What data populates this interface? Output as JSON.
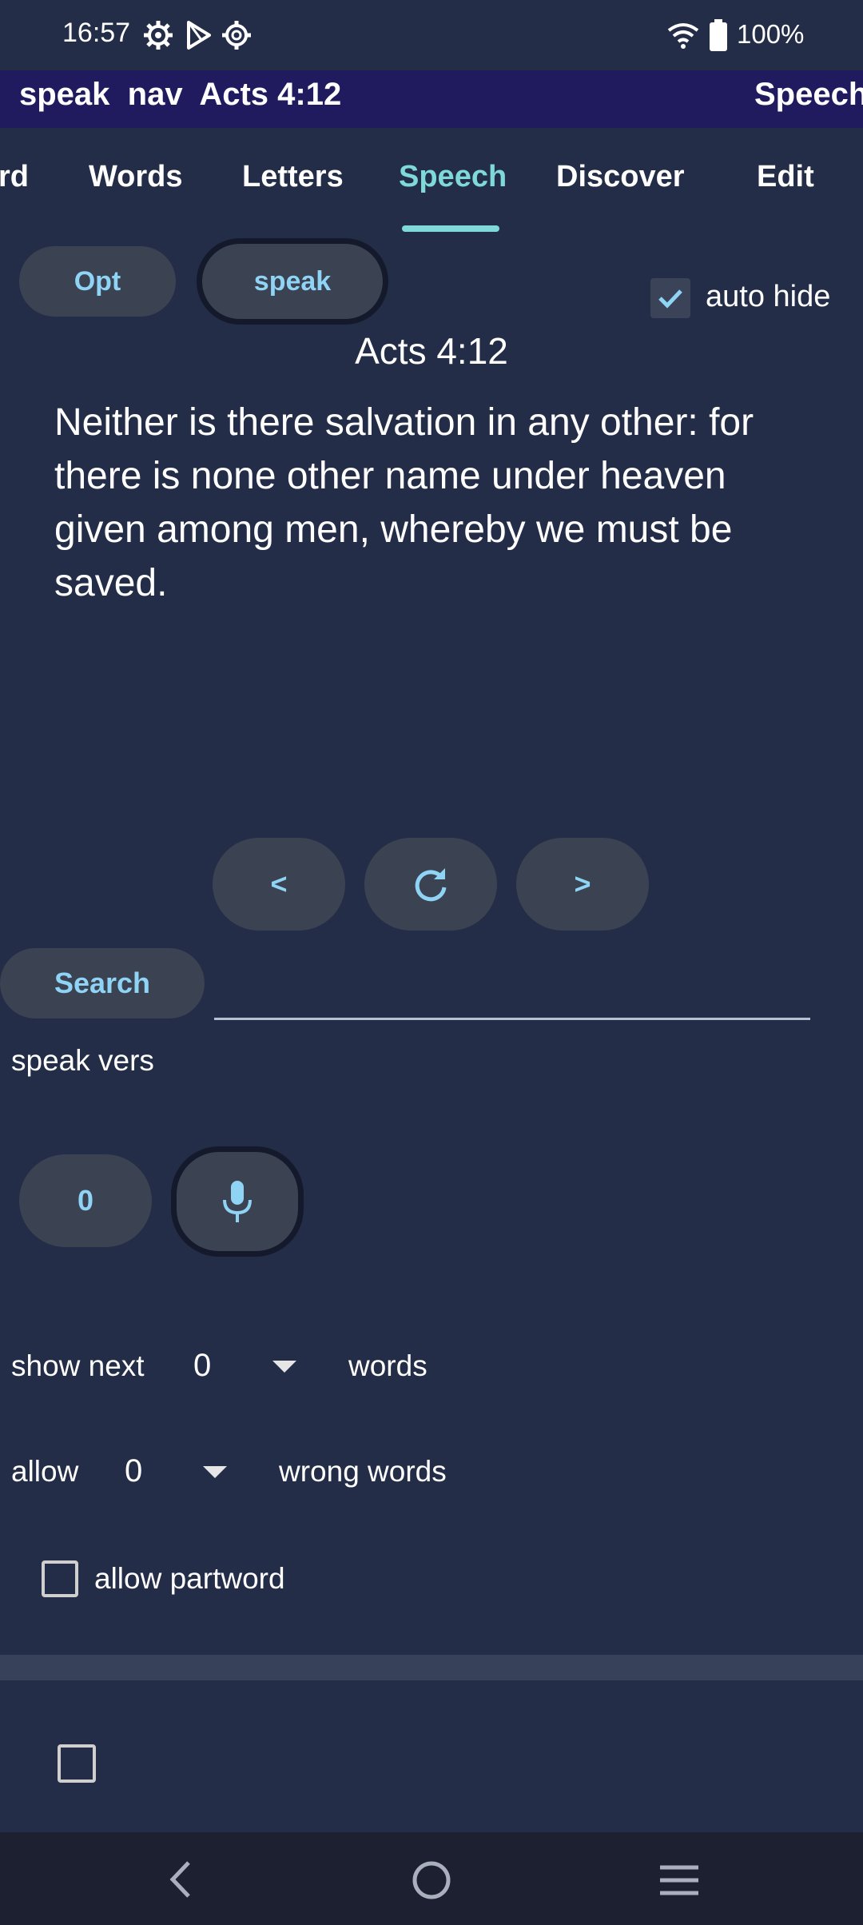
{
  "status_bar": {
    "time": "16:57",
    "left_icons": [
      "settings-gear-icon",
      "play-store-icon",
      "settings-cog-icon"
    ],
    "right_icons": [
      "wifi-icon",
      "battery-icon"
    ],
    "battery": "100%"
  },
  "title_bar": {
    "left": "speak  nav  Acts 4:12",
    "right": "Speech"
  },
  "tabs": [
    {
      "label": "rd"
    },
    {
      "label": "Words"
    },
    {
      "label": "Letters"
    },
    {
      "label": "Speech",
      "active": true
    },
    {
      "label": "Discover"
    },
    {
      "label": "Edit"
    }
  ],
  "controls": {
    "opt_label": "Opt",
    "speak_label": "speak",
    "auto_hide_label": "auto hide",
    "auto_hide_checked": true
  },
  "verse": {
    "reference": "Acts 4:12",
    "text": "Neither is there salvation in any other: for there is none other name under heaven given among men, whereby we must be saved."
  },
  "nav_buttons": {
    "prev_label": "<",
    "refresh_icon": "refresh-icon",
    "next_label": ">"
  },
  "search": {
    "button_label": "Search",
    "input_value": "",
    "hint": "speak vers"
  },
  "speech": {
    "counter_label": "0",
    "mic_icon": "microphone-icon"
  },
  "options": {
    "show_next_prefix": "show next",
    "show_next_value": "0",
    "show_next_suffix": "words",
    "allow_prefix": "allow",
    "allow_value": "0",
    "allow_suffix": "wrong words",
    "partword_label": "allow partword",
    "partword_checked": false,
    "bottom_checkbox_checked": false
  },
  "colors": {
    "background": "#232d47",
    "title_bar": "#1f1b5e",
    "accent": "#7fd9d9",
    "button_text": "#8fd3f5",
    "button_bg": "#3b4252"
  }
}
